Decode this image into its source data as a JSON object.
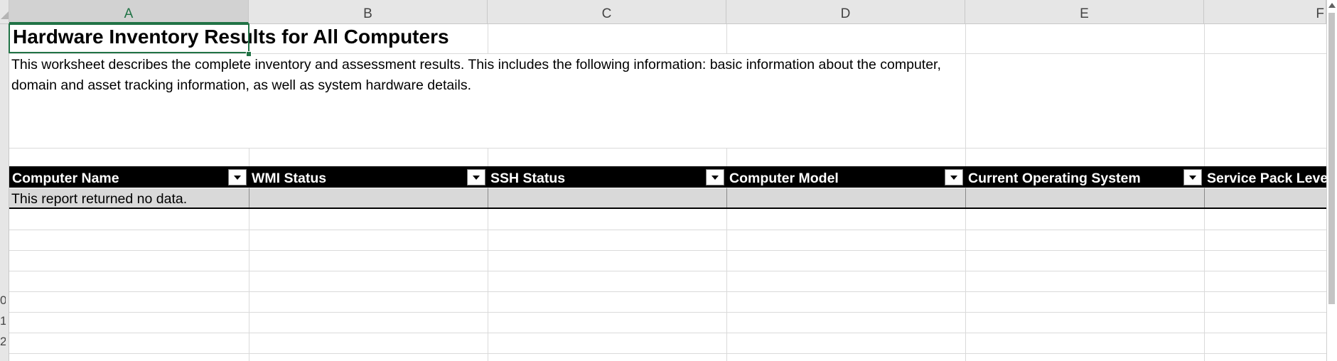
{
  "columns": [
    "A",
    "B",
    "C",
    "D",
    "E",
    "F"
  ],
  "selected_column": "A",
  "row_numbers": [
    "0",
    "1",
    "2"
  ],
  "title": "Hardware Inventory Results for All Computers",
  "description": "This worksheet describes the complete inventory and assessment results. This includes the following information: basic information about the computer, domain and asset tracking information, as well as system hardware details.",
  "table": {
    "headers": [
      "Computer Name",
      "WMI Status",
      "SSH Status",
      "Computer Model",
      "Current Operating System",
      "Service Pack Level,"
    ],
    "rows": [
      [
        "This report returned no data.",
        "",
        "",
        "",
        "",
        ""
      ]
    ],
    "header_bg": "#000000",
    "row_bg": "#d9d9d9"
  },
  "colors": {
    "selection": "#217346",
    "header_bar": "#e6e6e6",
    "gridline": "#dadada"
  }
}
